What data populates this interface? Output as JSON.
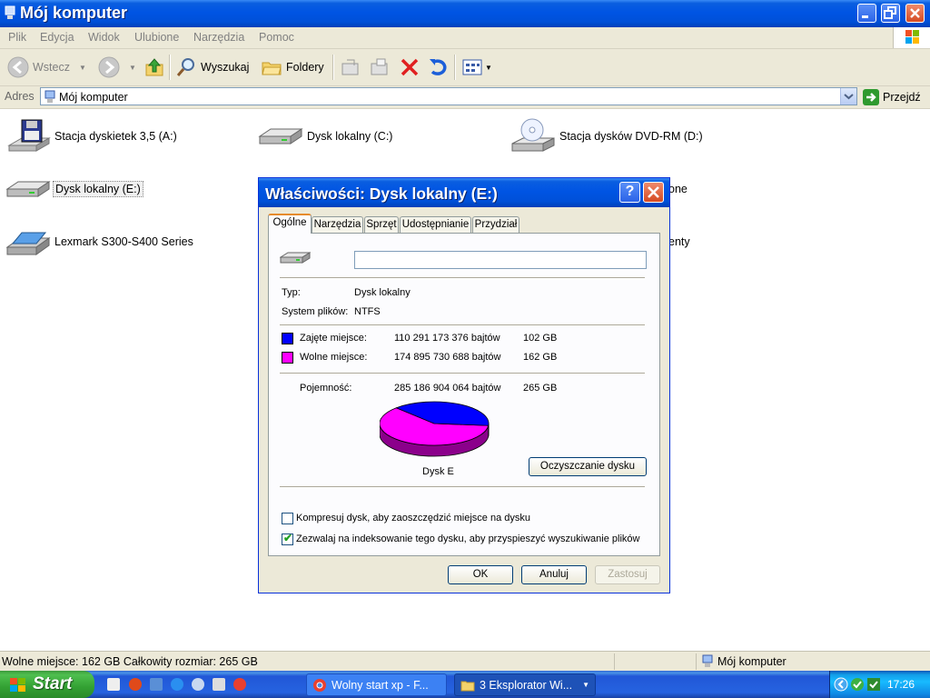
{
  "window": {
    "title": "Mój komputer"
  },
  "menu": [
    "Plik",
    "Edycja",
    "Widok",
    "Ulubione",
    "Narzędzia",
    "Pomoc"
  ],
  "toolbar": {
    "back": "Wstecz",
    "search": "Wyszukaj",
    "folders": "Foldery"
  },
  "address": {
    "label": "Adres",
    "value": "Mój komputer",
    "go": "Przejdź"
  },
  "items": [
    "Stacja dyskietek 3,5 (A:)",
    "Dysk lokalny (C:)",
    "Stacja dysków DVD-RM (D:)",
    "Dysk lokalny (E:)",
    "one",
    "Lexmark S300-S400 Series",
    "enty"
  ],
  "status": {
    "left": "Wolne miejsce: 162 GB Całkowity rozmiar: 265 GB",
    "right": "Mój komputer"
  },
  "taskbar": {
    "start": "Start",
    "tasks": [
      "Wolny start xp - F...",
      "3 Eksplorator Wi..."
    ],
    "clock": "17:26"
  },
  "dialog": {
    "title": "Właściwości: Dysk lokalny (E:)",
    "help": "?",
    "tabs": [
      "Ogólne",
      "Narzędzia",
      "Sprzęt",
      "Udostępnianie",
      "Przydział"
    ],
    "name_value": "",
    "type_label": "Typ:",
    "type_value": "Dysk lokalny",
    "fs_label": "System plików:",
    "fs_value": "NTFS",
    "used_label": "Zajęte miejsce:",
    "used_bytes": "110 291 173 376 bajtów",
    "used_gb": "102 GB",
    "free_label": "Wolne miejsce:",
    "free_bytes": "174 895 730 688 bajtów",
    "free_gb": "162 GB",
    "cap_label": "Pojemność:",
    "cap_bytes": "285 186 904 064 bajtów",
    "cap_gb": "265 GB",
    "used_fraction": 0.387,
    "used_color": "#0000ff",
    "free_color": "#ff00ff",
    "disk_label": "Dysk E",
    "cleanup": "Oczyszczanie dysku",
    "compress": "Kompresuj dysk, aby zaoszczędzić miejsce na dysku",
    "compress_checked": false,
    "index": "Zezwalaj na indeksowanie tego dysku, aby przyspieszyć wyszukiwanie plików",
    "index_checked": true,
    "ok": "OK",
    "cancel": "Anuluj",
    "apply": "Zastosuj"
  }
}
